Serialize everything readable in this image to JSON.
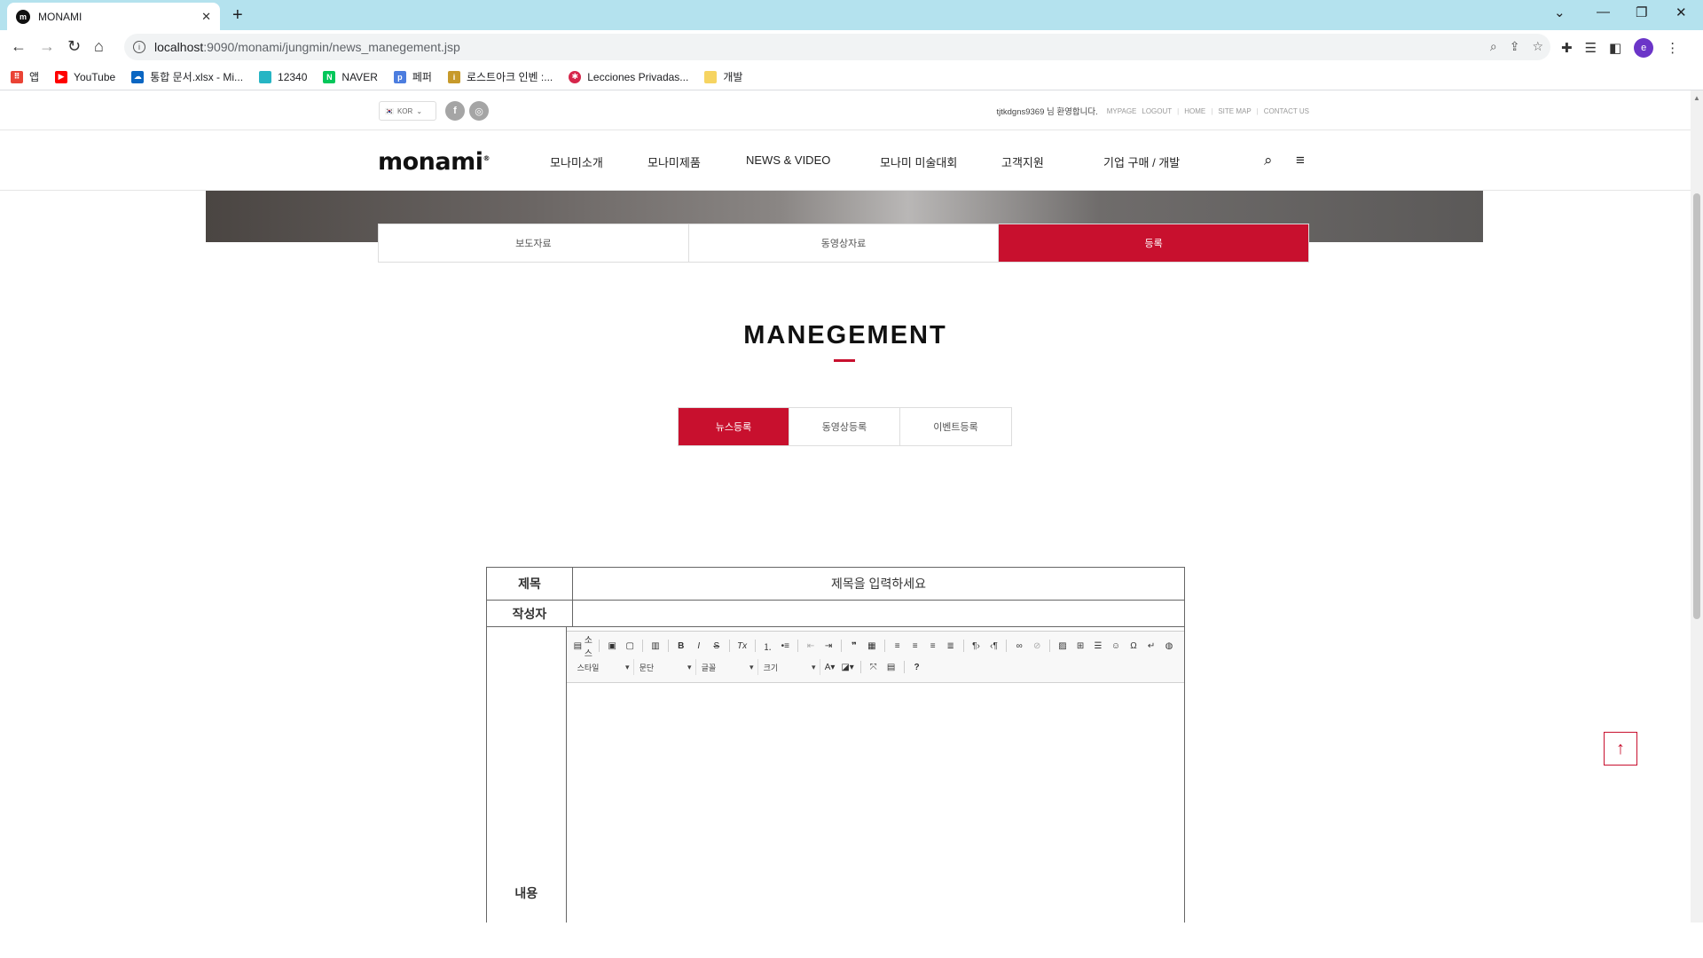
{
  "browser": {
    "tab_title": "MONAMI",
    "tab_favicon": "m",
    "url_host": "localhost",
    "url_path": ":9090/monami/jungmin/news_manegement.jsp",
    "profile_initial": "e",
    "bookmarks": [
      {
        "label": "앱",
        "icon": "apps-icon",
        "color": "#ea4335"
      },
      {
        "label": "YouTube",
        "icon": "youtube-icon",
        "color": "#ff0000"
      },
      {
        "label": "통합 문서.xlsx - Mi...",
        "icon": "onedrive-icon",
        "color": "#0a66c2"
      },
      {
        "label": "12340",
        "icon": "grid-icon",
        "color": "#26b5c4"
      },
      {
        "label": "NAVER",
        "icon": "naver-icon",
        "color": "#03c75a"
      },
      {
        "label": "페퍼",
        "icon": "papago-icon",
        "color": "#4c7ddf"
      },
      {
        "label": "로스트아크 인벤 :...",
        "icon": "inven-icon",
        "color": "#c79a2b"
      },
      {
        "label": "Lecciones Privadas...",
        "icon": "lecciones-icon",
        "color": "#d6264b"
      },
      {
        "label": "개발",
        "icon": "folder-icon",
        "color": "#f6d461"
      }
    ]
  },
  "header": {
    "lang": "KOR",
    "welcome": "tjtkdgns9369 님 환영합니다.",
    "util_links": [
      "MYPAGE",
      "LOGOUT",
      "HOME",
      "SITE MAP",
      "CONTACT US"
    ],
    "logo": "monami",
    "menu": [
      "모나미소개",
      "모나미제품",
      "NEWS & VIDEO",
      "모나미 미술대회",
      "고객지원",
      "기업 구매 / 개발"
    ]
  },
  "subtabs": [
    "보도자료",
    "동영상자료",
    "등록"
  ],
  "page_title": "MANEGEMENT",
  "register_tabs": [
    "뉴스등록",
    "동영상등록",
    "이벤트등록"
  ],
  "form": {
    "title_label": "제목",
    "title_placeholder": "제목을 입력하세요",
    "writer_label": "작성자",
    "content_label": "내용",
    "editor_source_label": "소스",
    "editor_combos": [
      "스타일",
      "문단",
      "글꼴",
      "크기"
    ]
  },
  "colors": {
    "accent": "#c8102e",
    "tabbar": "#b4e2ee"
  }
}
